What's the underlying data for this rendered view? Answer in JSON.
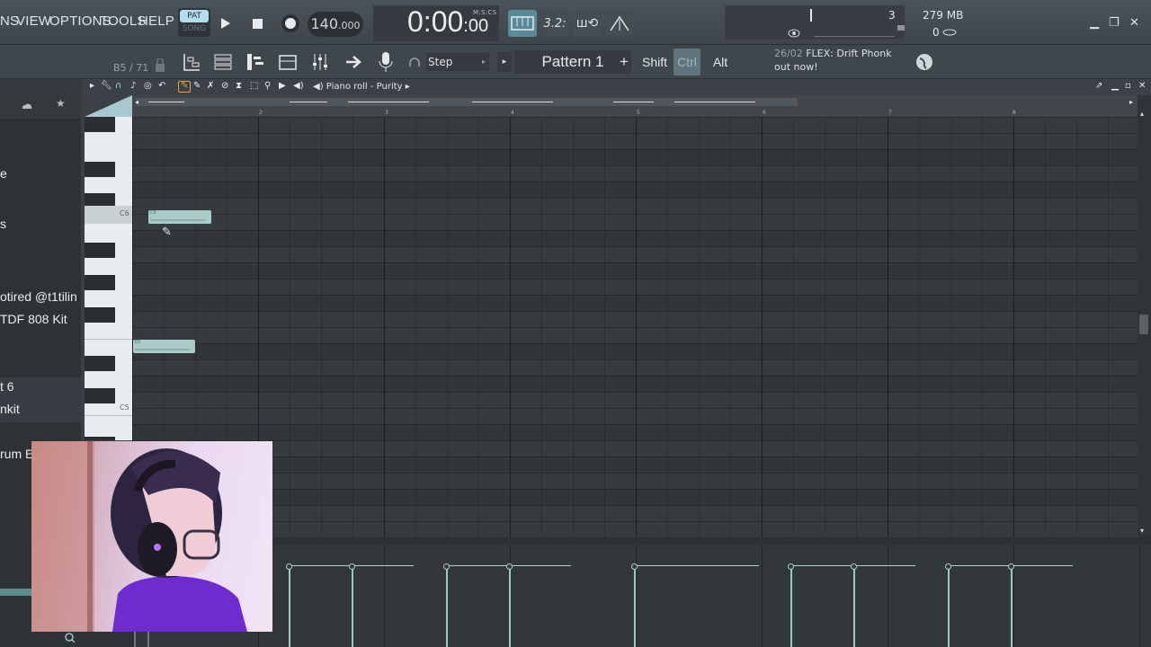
{
  "menu": {
    "items": [
      "NS",
      "VIEW",
      "OPTIONS",
      "TOOLS",
      "HELP"
    ]
  },
  "transport": {
    "pat_label": "PAT",
    "song_label": "SONG",
    "tempo_main": "140",
    "tempo_frac": ".000",
    "time_main": "0:00",
    "time_sub": ":00",
    "time_format": "M:S:CS"
  },
  "system": {
    "cpu": "3",
    "memory": "279 MB",
    "polyphony": "0"
  },
  "toolbar": {
    "position": "B5 / 71",
    "snap": "Step",
    "pattern": "Pattern 1",
    "pattern_add": "+",
    "shift": "Shift",
    "ctrl": "Ctrl",
    "alt": "Alt",
    "news_date": "26/02",
    "news_text": "FLEX: Drift Phonk",
    "news_text2": "out now!"
  },
  "browser": {
    "items": [
      "e",
      "s",
      "otired @t1tilin",
      "TDF 808 Kit",
      "t 6",
      "nkit",
      "rum E"
    ]
  },
  "piano_roll": {
    "title": "Piano roll - Purity",
    "bar_numbers": [
      "2",
      "3",
      "4",
      "5",
      "6",
      "7",
      "8"
    ],
    "key_labels": {
      "c6": "C6",
      "c5": "C5"
    },
    "notes": [
      {
        "label": "C6"
      },
      {
        "label": "E5"
      }
    ]
  },
  "colors": {
    "note": "#a9ccc8",
    "accent": "#b5dcea",
    "background": "#363b3f"
  }
}
